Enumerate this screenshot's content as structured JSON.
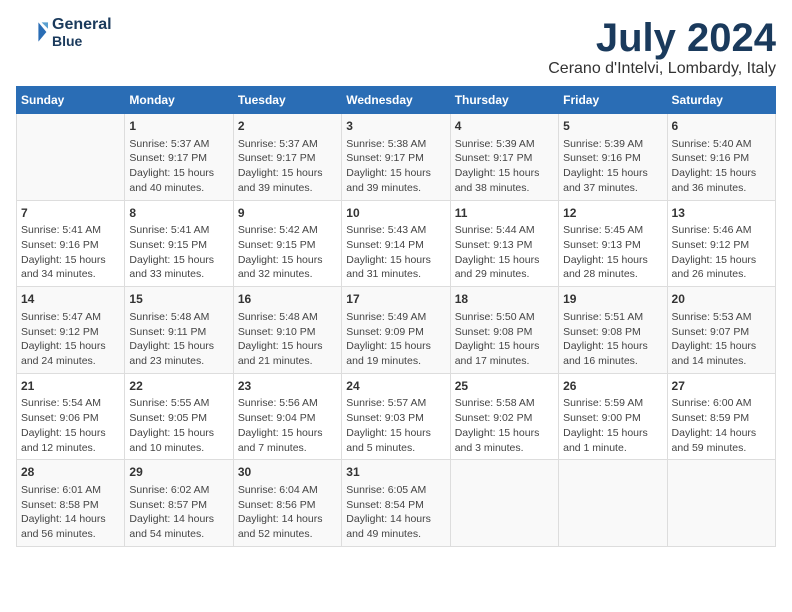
{
  "header": {
    "logo_line1": "General",
    "logo_line2": "Blue",
    "main_title": "July 2024",
    "subtitle": "Cerano d'Intelvi, Lombardy, Italy"
  },
  "columns": [
    "Sunday",
    "Monday",
    "Tuesday",
    "Wednesday",
    "Thursday",
    "Friday",
    "Saturday"
  ],
  "weeks": [
    {
      "cells": [
        {
          "day": "",
          "text": ""
        },
        {
          "day": "1",
          "text": "Sunrise: 5:37 AM\nSunset: 9:17 PM\nDaylight: 15 hours\nand 40 minutes."
        },
        {
          "day": "2",
          "text": "Sunrise: 5:37 AM\nSunset: 9:17 PM\nDaylight: 15 hours\nand 39 minutes."
        },
        {
          "day": "3",
          "text": "Sunrise: 5:38 AM\nSunset: 9:17 PM\nDaylight: 15 hours\nand 39 minutes."
        },
        {
          "day": "4",
          "text": "Sunrise: 5:39 AM\nSunset: 9:17 PM\nDaylight: 15 hours\nand 38 minutes."
        },
        {
          "day": "5",
          "text": "Sunrise: 5:39 AM\nSunset: 9:16 PM\nDaylight: 15 hours\nand 37 minutes."
        },
        {
          "day": "6",
          "text": "Sunrise: 5:40 AM\nSunset: 9:16 PM\nDaylight: 15 hours\nand 36 minutes."
        }
      ]
    },
    {
      "cells": [
        {
          "day": "7",
          "text": "Sunrise: 5:41 AM\nSunset: 9:16 PM\nDaylight: 15 hours\nand 34 minutes."
        },
        {
          "day": "8",
          "text": "Sunrise: 5:41 AM\nSunset: 9:15 PM\nDaylight: 15 hours\nand 33 minutes."
        },
        {
          "day": "9",
          "text": "Sunrise: 5:42 AM\nSunset: 9:15 PM\nDaylight: 15 hours\nand 32 minutes."
        },
        {
          "day": "10",
          "text": "Sunrise: 5:43 AM\nSunset: 9:14 PM\nDaylight: 15 hours\nand 31 minutes."
        },
        {
          "day": "11",
          "text": "Sunrise: 5:44 AM\nSunset: 9:13 PM\nDaylight: 15 hours\nand 29 minutes."
        },
        {
          "day": "12",
          "text": "Sunrise: 5:45 AM\nSunset: 9:13 PM\nDaylight: 15 hours\nand 28 minutes."
        },
        {
          "day": "13",
          "text": "Sunrise: 5:46 AM\nSunset: 9:12 PM\nDaylight: 15 hours\nand 26 minutes."
        }
      ]
    },
    {
      "cells": [
        {
          "day": "14",
          "text": "Sunrise: 5:47 AM\nSunset: 9:12 PM\nDaylight: 15 hours\nand 24 minutes."
        },
        {
          "day": "15",
          "text": "Sunrise: 5:48 AM\nSunset: 9:11 PM\nDaylight: 15 hours\nand 23 minutes."
        },
        {
          "day": "16",
          "text": "Sunrise: 5:48 AM\nSunset: 9:10 PM\nDaylight: 15 hours\nand 21 minutes."
        },
        {
          "day": "17",
          "text": "Sunrise: 5:49 AM\nSunset: 9:09 PM\nDaylight: 15 hours\nand 19 minutes."
        },
        {
          "day": "18",
          "text": "Sunrise: 5:50 AM\nSunset: 9:08 PM\nDaylight: 15 hours\nand 17 minutes."
        },
        {
          "day": "19",
          "text": "Sunrise: 5:51 AM\nSunset: 9:08 PM\nDaylight: 15 hours\nand 16 minutes."
        },
        {
          "day": "20",
          "text": "Sunrise: 5:53 AM\nSunset: 9:07 PM\nDaylight: 15 hours\nand 14 minutes."
        }
      ]
    },
    {
      "cells": [
        {
          "day": "21",
          "text": "Sunrise: 5:54 AM\nSunset: 9:06 PM\nDaylight: 15 hours\nand 12 minutes."
        },
        {
          "day": "22",
          "text": "Sunrise: 5:55 AM\nSunset: 9:05 PM\nDaylight: 15 hours\nand 10 minutes."
        },
        {
          "day": "23",
          "text": "Sunrise: 5:56 AM\nSunset: 9:04 PM\nDaylight: 15 hours\nand 7 minutes."
        },
        {
          "day": "24",
          "text": "Sunrise: 5:57 AM\nSunset: 9:03 PM\nDaylight: 15 hours\nand 5 minutes."
        },
        {
          "day": "25",
          "text": "Sunrise: 5:58 AM\nSunset: 9:02 PM\nDaylight: 15 hours\nand 3 minutes."
        },
        {
          "day": "26",
          "text": "Sunrise: 5:59 AM\nSunset: 9:00 PM\nDaylight: 15 hours\nand 1 minute."
        },
        {
          "day": "27",
          "text": "Sunrise: 6:00 AM\nSunset: 8:59 PM\nDaylight: 14 hours\nand 59 minutes."
        }
      ]
    },
    {
      "cells": [
        {
          "day": "28",
          "text": "Sunrise: 6:01 AM\nSunset: 8:58 PM\nDaylight: 14 hours\nand 56 minutes."
        },
        {
          "day": "29",
          "text": "Sunrise: 6:02 AM\nSunset: 8:57 PM\nDaylight: 14 hours\nand 54 minutes."
        },
        {
          "day": "30",
          "text": "Sunrise: 6:04 AM\nSunset: 8:56 PM\nDaylight: 14 hours\nand 52 minutes."
        },
        {
          "day": "31",
          "text": "Sunrise: 6:05 AM\nSunset: 8:54 PM\nDaylight: 14 hours\nand 49 minutes."
        },
        {
          "day": "",
          "text": ""
        },
        {
          "day": "",
          "text": ""
        },
        {
          "day": "",
          "text": ""
        }
      ]
    }
  ]
}
